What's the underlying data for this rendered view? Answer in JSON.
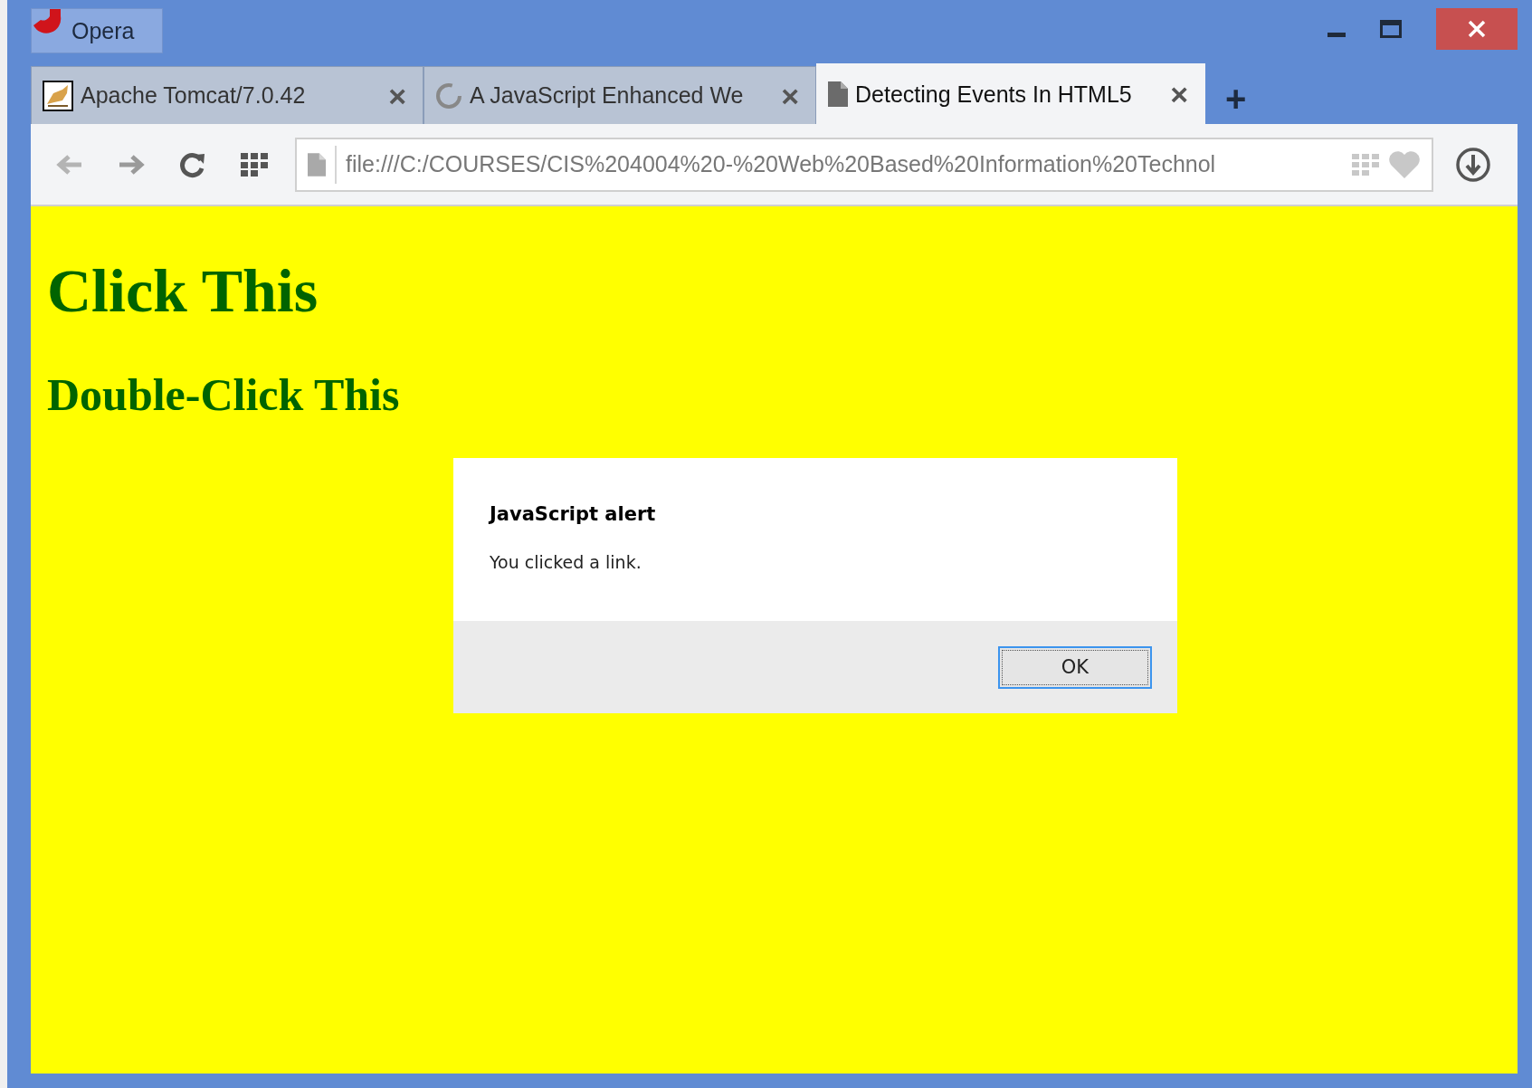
{
  "window": {
    "app_button": "Opera"
  },
  "tabs": [
    {
      "label": "Apache Tomcat/7.0.42",
      "selected": false,
      "kind": "image",
      "close": "×"
    },
    {
      "label": "A JavaScript Enhanced We",
      "selected": false,
      "kind": "loading",
      "close": "×"
    },
    {
      "label": "Detecting Events In HTML5",
      "selected": true,
      "kind": "page",
      "close": "×"
    }
  ],
  "new_tab": "+",
  "address_bar": {
    "value": "file:///C:/COURSES/CIS%204004%20-%20Web%20Based%20Information%20Technol"
  },
  "page": {
    "heading_1": "Click This",
    "heading_2": "Double-Click This"
  },
  "alert": {
    "title": "JavaScript alert",
    "message": "You clicked a link.",
    "buttons": [
      "OK"
    ]
  }
}
